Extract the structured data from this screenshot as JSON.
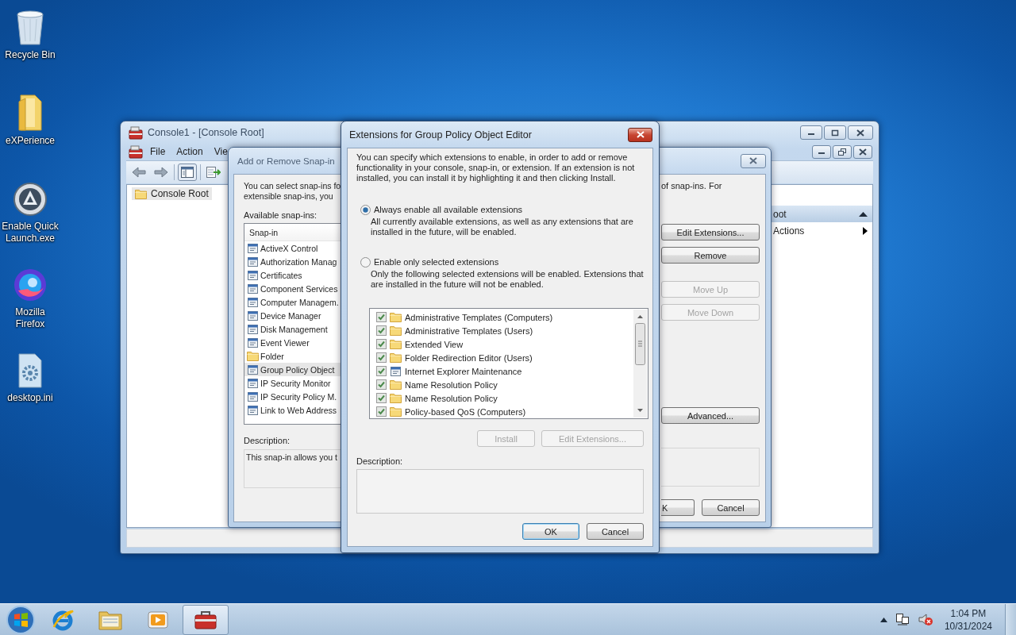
{
  "desktop_icons": [
    {
      "label": "Recycle Bin",
      "kind": "recycle"
    },
    {
      "label": "eXPerience",
      "kind": "folder"
    },
    {
      "label": "Enable Quick Launch.exe",
      "kind": "app"
    },
    {
      "label": "Mozilla Firefox",
      "kind": "browser"
    },
    {
      "label": "desktop.ini",
      "kind": "file"
    }
  ],
  "console_window": {
    "title": "Console1 - [Console Root]",
    "menu": [
      "File",
      "Action",
      "Vie"
    ],
    "tree": [
      {
        "label": "Console Root",
        "selected": true
      }
    ],
    "actions_pane": {
      "header": "oot",
      "items": [
        "Actions"
      ]
    }
  },
  "snapins_dialog": {
    "title": "Add or Remove Snap-in",
    "intro_left": [
      "You can select snap-ins fo",
      "extensible snap-ins, you"
    ],
    "intro_right": "of snap-ins. For",
    "available_label": "Available snap-ins:",
    "column": "Snap-in",
    "items": [
      {
        "label": "ActiveX Control",
        "kind": "tool",
        "selected": false
      },
      {
        "label": "Authorization Manag",
        "kind": "tool",
        "selected": false
      },
      {
        "label": "Certificates",
        "kind": "tool",
        "selected": false
      },
      {
        "label": "Component Services",
        "kind": "tool",
        "selected": false
      },
      {
        "label": "Computer Managem.",
        "kind": "tool",
        "selected": false
      },
      {
        "label": "Device Manager",
        "kind": "tool",
        "selected": false
      },
      {
        "label": "Disk Management",
        "kind": "tool",
        "selected": false
      },
      {
        "label": "Event Viewer",
        "kind": "tool",
        "selected": false
      },
      {
        "label": "Folder",
        "kind": "folder",
        "selected": false
      },
      {
        "label": "Group Policy Object",
        "kind": "tool",
        "selected": true
      },
      {
        "label": "IP Security Monitor",
        "kind": "tool",
        "selected": false
      },
      {
        "label": "IP Security Policy M.",
        "kind": "tool",
        "selected": false
      },
      {
        "label": "Link to Web Address",
        "kind": "tool",
        "selected": false
      }
    ],
    "description_label": "Description:",
    "description": "This snap-in allows you t",
    "buttons": [
      {
        "label": "Edit Extensions...",
        "disabled": false
      },
      {
        "label": "Remove",
        "disabled": false
      },
      {
        "label": "Move Up",
        "disabled": true
      },
      {
        "label": "Move Down",
        "disabled": true
      },
      {
        "label": "Advanced...",
        "disabled": false
      }
    ],
    "ok": "K",
    "cancel": "Cancel"
  },
  "extensions_dialog": {
    "title": "Extensions for Group Policy Object Editor",
    "intro": "You can specify which extensions to enable, in order to add or remove functionality in your console, snap-in, or extension. If an extension is not installed, you can install it by highlighting it and then clicking Install.",
    "options": [
      {
        "label": "Always enable all available extensions",
        "detail": "All currently available extensions, as well as any extensions that are installed in the future, will be enabled.",
        "selected": true
      },
      {
        "label": "Enable only selected extensions",
        "detail": "Only the following selected extensions will be enabled. Extensions that are installed in the future will not be enabled.",
        "selected": false
      }
    ],
    "extensions": [
      {
        "label": "Administrative Templates (Computers)",
        "kind": "folder",
        "checked": true
      },
      {
        "label": "Administrative Templates (Users)",
        "kind": "folder",
        "checked": true
      },
      {
        "label": "Extended View",
        "kind": "folder",
        "checked": true
      },
      {
        "label": "Folder Redirection Editor (Users)",
        "kind": "folder",
        "checked": true
      },
      {
        "label": "Internet Explorer Maintenance",
        "kind": "tool",
        "checked": true
      },
      {
        "label": "Name Resolution Policy",
        "kind": "folder",
        "checked": true
      },
      {
        "label": "Name Resolution Policy",
        "kind": "folder",
        "checked": true
      },
      {
        "label": "Policy-based QoS (Computers)",
        "kind": "folder",
        "checked": true
      }
    ],
    "buttons": [
      {
        "label": "Install",
        "disabled": true
      },
      {
        "label": "Edit Extensions...",
        "disabled": true
      }
    ],
    "description_label": "Description:",
    "ok": "OK",
    "cancel": "Cancel"
  },
  "taskbar": {
    "apps": [
      {
        "kind": "browser",
        "selected": false
      },
      {
        "kind": "explorer",
        "selected": false
      },
      {
        "kind": "media",
        "selected": false
      },
      {
        "kind": "console",
        "selected": true
      }
    ],
    "clock": {
      "time": "1:04 PM",
      "date": "10/31/2024"
    }
  }
}
